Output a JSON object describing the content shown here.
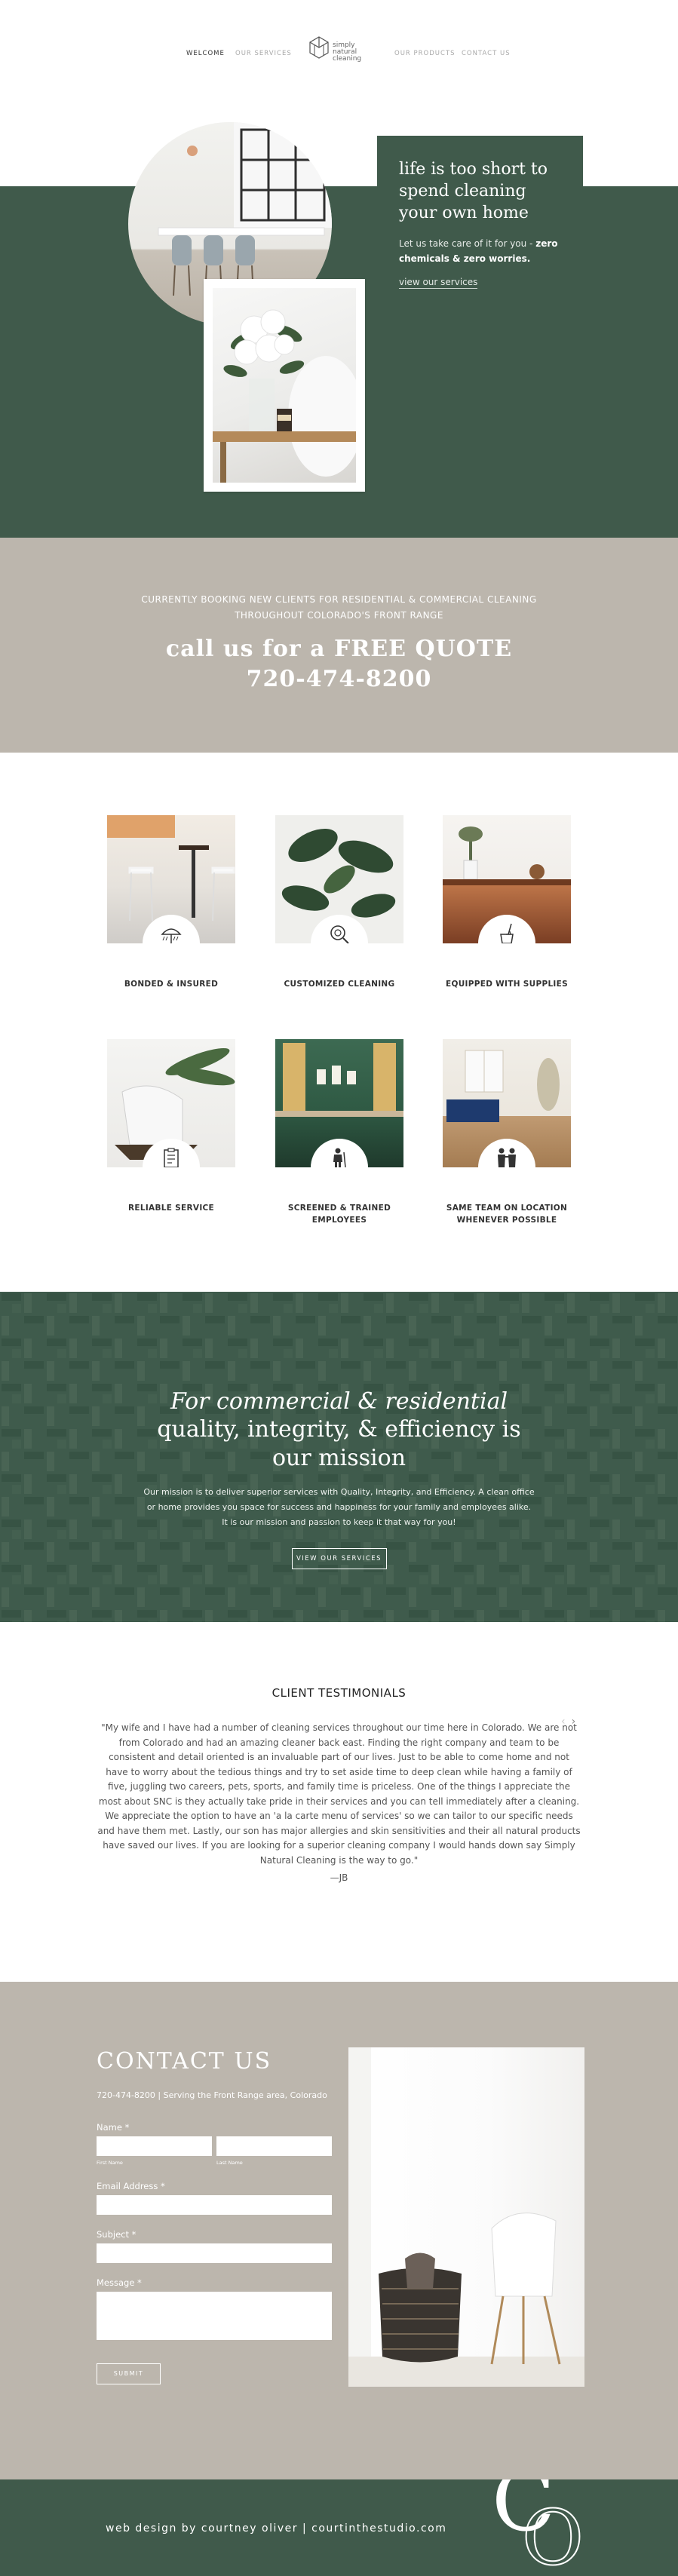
{
  "nav": {
    "links": [
      "WELCOME",
      "OUR SERVICES",
      "OUR PRODUCTS",
      "CONTACT US"
    ],
    "logo": {
      "line1": "simply",
      "line2": "natural",
      "line3": "cleaning",
      "icon": "hexagon-cube-logo-icon"
    }
  },
  "hero": {
    "title": "life is too short to spend cleaning your own home",
    "text_start": "Let us take care of it for you - ",
    "text_bold": "zero chemicals & zero worries.",
    "link": "view our services"
  },
  "quote": {
    "small": "CURRENTLY BOOKING NEW CLIENTS FOR RESIDENTIAL & COMMERCIAL CLEANING THROUGHOUT COLORADO'S FRONT RANGE",
    "line1": "call us for a FREE QUOTE",
    "phone": "720-474-8200"
  },
  "features": [
    {
      "label": "BONDED & INSURED",
      "icon": "umbrella-icon"
    },
    {
      "label": "CUSTOMIZED CLEANING",
      "icon": "magnifier-icon"
    },
    {
      "label": "EQUIPPED WITH SUPPLIES",
      "icon": "bucket-mop-icon"
    },
    {
      "label": "RELIABLE SERVICE",
      "icon": "clipboard-icon"
    },
    {
      "label": "SCREENED & TRAINED EMPLOYEES",
      "icon": "cleaner-person-icon"
    },
    {
      "label": "SAME TEAM ON LOCATION WHENEVER POSSIBLE",
      "icon": "team-icon"
    }
  ],
  "mission": {
    "italic": "For commercial & residential",
    "title": "quality, integrity, & efficiency is our mission",
    "text": "Our mission is to deliver superior services with Quality, Integrity, and Efficiency. A clean office or home provides you space for success and happiness for your family and employees alike. It is our mission and passion to keep it that way for you!",
    "button": "VIEW OUR SERVICES"
  },
  "testimonials": {
    "heading": "CLIENT TESTIMONIALS",
    "quote": "\"My wife and I have had a number of cleaning services throughout our time here in Colorado. We are not from Colorado and had an amazing cleaner back east. Finding the right company and team to be consistent and detail oriented is an invaluable part of our lives. Just to be able to come home and not have to worry about the tedious things and try to set aside time to deep clean while having a family of five, juggling two careers, pets, sports, and family time is priceless. One of the things I appreciate the most about SNC is they actually take pride in their services and you can tell immediately after a cleaning. We appreciate the option to have an 'a la carte menu of services' so we can tailor to our specific needs and have them met. Lastly, our son has major allergies and skin sensitivities and their all natural products have saved our lives. If you are looking for a superior cleaning company I would hands down say Simply Natural Cleaning is the way to go.\"",
    "author": "—JB",
    "prev": "‹",
    "next": "›"
  },
  "contact": {
    "title": "CONTACT US",
    "info": "720-474-8200  |  Serving the Front Range area, Colorado",
    "name_label": "Name *",
    "first_name": "First Name",
    "last_name": "Last Name",
    "email_label": "Email Address *",
    "subject_label": "Subject *",
    "message_label": "Message *",
    "submit": "SUBMIT"
  },
  "footer": {
    "text": "web design by courtney oliver  |  courtinthestudio.com",
    "monogram_c": "C",
    "monogram_o": "O"
  },
  "colors": {
    "green": "#405a4b",
    "taupe": "#bcb6ad",
    "white": "#ffffff"
  }
}
